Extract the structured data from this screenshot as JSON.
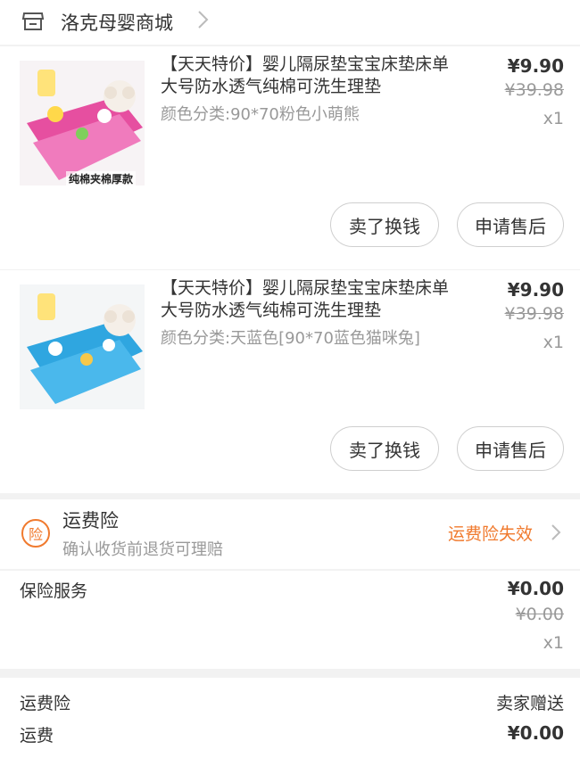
{
  "store": {
    "name": "洛克母婴商城",
    "icon": "store-icon"
  },
  "items": [
    {
      "thumb_caption": "纯棉夹棉厚款",
      "title": "【天天特价】婴儿隔尿垫宝宝床垫床单大号防水透气纯棉可洗生理垫",
      "variant": "颜色分类:90*70粉色小萌熊",
      "price": "¥9.90",
      "orig_price": "¥39.98",
      "qty": "x1",
      "btn_sell": "卖了换钱",
      "btn_after": "申请售后"
    },
    {
      "thumb_caption": "",
      "title": "【天天特价】婴儿隔尿垫宝宝床垫床单大号防水透气纯棉可洗生理垫",
      "variant": "颜色分类:天蓝色[90*70蓝色猫咪兔]",
      "price": "¥9.90",
      "orig_price": "¥39.98",
      "qty": "x1",
      "btn_sell": "卖了换钱",
      "btn_after": "申请售后"
    }
  ],
  "shipping_insurance": {
    "icon_text": "险",
    "title": "运费险",
    "subtitle": "确认收货前退货可理赔",
    "status": "运费险失效",
    "accent": "#f07a2e"
  },
  "insurance_service": {
    "label": "保险服务",
    "price": "¥0.00",
    "orig_price": "¥0.00",
    "qty": "x1"
  },
  "footer": {
    "row1_label": "运费险",
    "row1_value": "卖家赠送",
    "row2_label": "运费",
    "row2_value": "¥0.00"
  }
}
